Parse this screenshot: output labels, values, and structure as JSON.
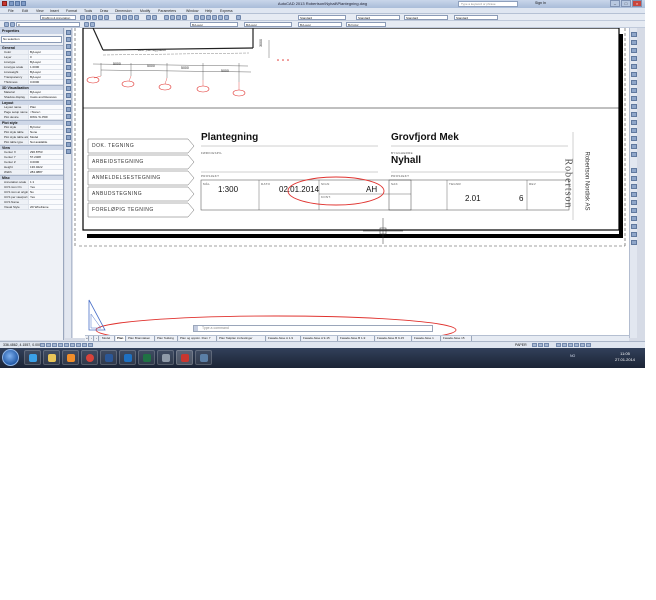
{
  "window": {
    "title": "AutoCAD 2013  Robertson\\Nyhall\\Plantegning.dwg",
    "search_placeholder": "Type a keyword or phrase",
    "signin": "Sign In"
  },
  "menu": [
    "File",
    "Edit",
    "View",
    "Insert",
    "Format",
    "Tools",
    "Draw",
    "Dimension",
    "Modify",
    "Parameters",
    "Window",
    "Help",
    "Express"
  ],
  "toolbar": {
    "workspace": "Drafting & Annotation",
    "layer": "0",
    "text_style": "Standard",
    "dim_style": "Standard",
    "table_style": "Standard",
    "multileader_style": "Standard",
    "color": "ByLayer",
    "linetype": "ByLayer",
    "lineweight": "ByLayer",
    "plotstyle": "ByColor"
  },
  "properties": {
    "header": "Properties",
    "selection": "No selection",
    "sections": [
      {
        "name": "General",
        "rows": [
          {
            "k": "Color",
            "v": "ByLayer"
          },
          {
            "k": "Layer",
            "v": "0"
          },
          {
            "k": "Linetype",
            "v": "ByLayer"
          },
          {
            "k": "Linetype scale",
            "v": "1.0000"
          },
          {
            "k": "Lineweight",
            "v": "ByLayer"
          },
          {
            "k": "Transparency",
            "v": "ByLayer"
          },
          {
            "k": "Thickness",
            "v": "0.0000"
          }
        ]
      },
      {
        "name": "3D Visualization",
        "rows": [
          {
            "k": "Material",
            "v": "ByLayer"
          },
          {
            "k": "Shadow display",
            "v": "Casts and Receives"
          }
        ]
      },
      {
        "name": "Layout",
        "rows": [
          {
            "k": "Layout name",
            "v": "Plan"
          },
          {
            "k": "Page setup name",
            "v": "<None>"
          },
          {
            "k": "Plot device",
            "v": "DWG To PDF"
          }
        ]
      },
      {
        "name": "Plot style",
        "rows": [
          {
            "k": "Plot style",
            "v": "ByColor"
          },
          {
            "k": "Plot style table",
            "v": "None"
          },
          {
            "k": "Plot style table attached",
            "v": "Model"
          },
          {
            "k": "Plot table type",
            "v": "Not available"
          }
        ]
      },
      {
        "name": "View",
        "rows": [
          {
            "k": "Center X",
            "v": "296.8753"
          },
          {
            "k": "Center Y",
            "v": "57.2408"
          },
          {
            "k": "Center Z",
            "v": "0.0000"
          },
          {
            "k": "Height",
            "v": "136.0222"
          },
          {
            "k": "Width",
            "v": "284.0887"
          }
        ]
      },
      {
        "name": "Misc",
        "rows": [
          {
            "k": "Annotation scale",
            "v": "1:1"
          },
          {
            "k": "UCS icon On",
            "v": "Yes"
          },
          {
            "k": "UCS icon at origin",
            "v": "No"
          },
          {
            "k": "UCS per viewport",
            "v": "Yes"
          },
          {
            "k": "UCS Name",
            "v": ""
          },
          {
            "k": "Visual Style",
            "v": "2D Wireframe"
          }
        ]
      }
    ]
  },
  "drawing": {
    "dims": [
      "5000",
      "5000",
      "5000",
      "5000",
      "3000"
    ],
    "top_label": "Ekst. yttervegg/takfot",
    "doc_types": [
      "DOK. TEGNING",
      "ARBEIDSTEGNING",
      "ANMELDELSESTEGNING",
      "ANBUDSTEGNING",
      "FORELØPIG TEGNING"
    ],
    "title": "Plantegning",
    "subtitle_label": "FØRINGSPIL",
    "project_label": "PROSJEKT",
    "client": "Grovfjord Mek",
    "byggherre_label": "BYGGHERRE",
    "site": "Nyhall",
    "prosjekt_label": "PROSJEKT",
    "fields": {
      "scale_label": "MÅL",
      "scale": "1:300",
      "date_label": "DATO",
      "date": "02.01.2014",
      "drawn_label": "SIGN",
      "drawn": "AH",
      "checked_label": "KONT.",
      "contract_label": "SAK",
      "drawing_no_label": "TEGNR",
      "drawing_no": "2.01",
      "rev_label": "REV",
      "rev": "6"
    },
    "company_logo": "Robertson",
    "company_name": "Robertson Nordisk AS"
  },
  "command": {
    "placeholder": "Type a command"
  },
  "tabs": [
    "Model",
    "Plan",
    "Plan Branntaken",
    "Plan Tekking",
    "Plan og oppstn. Rom 7",
    "Plan Takplan innfestinger",
    "Fasade Akse A 1-9",
    "Fasade Akse A 9-15",
    "Fasade Akse B 1-9",
    "Fasade Akse B 9-15",
    "Fasade Akse 1",
    "Fasade Akse 15"
  ],
  "active_tab_index": 1,
  "status": {
    "coords": "336.4862, 4.1557, 0.0000",
    "paper": "PAPER"
  },
  "taskbar": {
    "time": "11:05",
    "date": "27.01.2014",
    "lang": "NO"
  },
  "colors": {
    "annotation_red": "#e0332f",
    "autocad_red": "#c8362f"
  }
}
